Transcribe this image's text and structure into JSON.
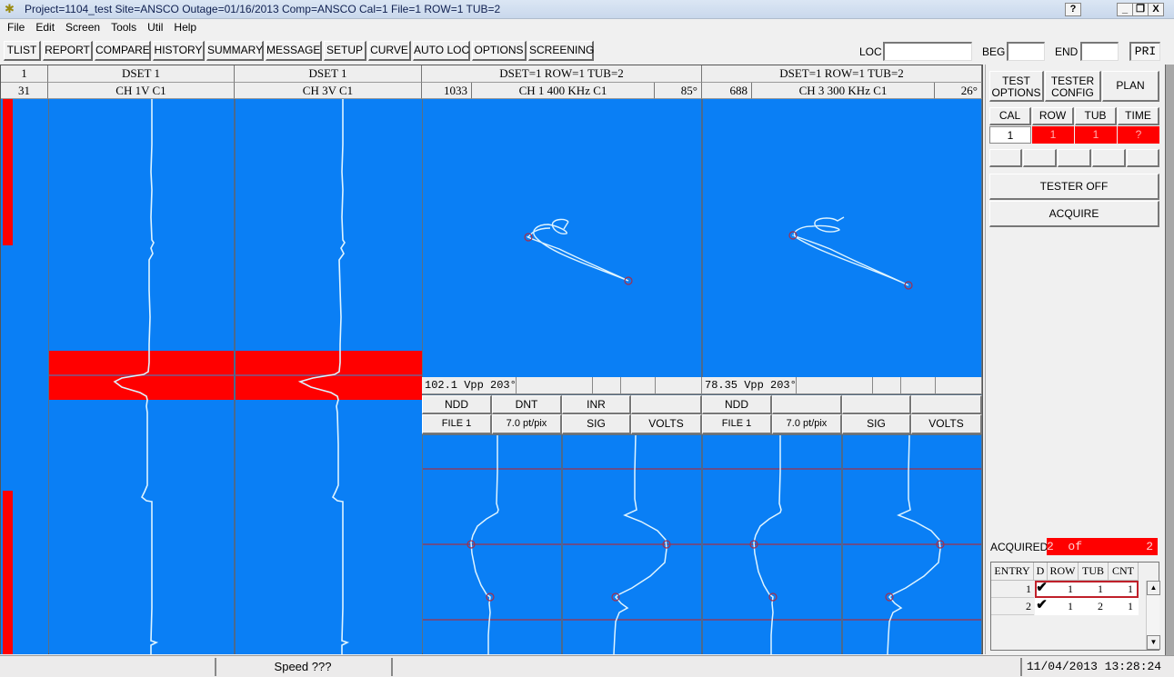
{
  "window": {
    "title": "Project=1104_test Site=ANSCO Outage=01/16/2013 Comp=ANSCO Cal=1 File=1 ROW=1  TUB=2",
    "app_icon": "eddy-current-app-icon",
    "help_btn": "?",
    "minimize_btn": "_",
    "restore_btn": "ɑ",
    "close_btn": "X"
  },
  "menu": [
    "File",
    "Edit",
    "Screen",
    "Tools",
    "Util",
    "Help"
  ],
  "toolbar": {
    "buttons": [
      "TLIST",
      "REPORT",
      "COMPARE",
      "HISTORY",
      "SUMMARY",
      "MESSAGE",
      "SETUP",
      "CURVE",
      "AUTO LOC",
      "OPTIONS",
      "SCREENING"
    ],
    "loc_label": "LOC",
    "loc_value": "",
    "beg_label": "BEG",
    "beg_value": "",
    "end_label": "END",
    "end_value": "",
    "pri_label": "PRI"
  },
  "strip": {
    "header_top": "1",
    "header_bottom": "31",
    "marker_color": "#ff0000"
  },
  "strip_charts": [
    {
      "dset": "DSET 1",
      "channel": "CH 1V C1"
    },
    {
      "dset": "DSET 1",
      "channel": "CH 3V C1"
    }
  ],
  "lissajous": [
    {
      "header": "DSET=1 ROW=1 TUB=2",
      "count": "1033",
      "channel": "CH 1 400 KHz C1",
      "angle": "85°",
      "readout": "102.1 Vpp 203°",
      "row1": [
        "NDD",
        "DNT",
        "INR",
        ""
      ],
      "row2": [
        "FILE 1",
        "7.0 pt/pix",
        "SIG",
        "VOLTS"
      ]
    },
    {
      "header": "DSET=1 ROW=1 TUB=2",
      "count": "688",
      "channel": "CH 3 300 KHz C1",
      "angle": "26°",
      "readout": "78.35 Vpp 203°",
      "row1": [
        "NDD",
        "",
        "",
        ""
      ],
      "row2": [
        "FILE 1",
        "7.0 pt/pix",
        "SIG",
        "VOLTS"
      ]
    }
  ],
  "colors": {
    "plot_bg": "#0a7ff5",
    "trace": "#dff4ff",
    "highlight": "#ff0000",
    "cursor_line": "#b0304a"
  },
  "right_panel": {
    "buttons_top": [
      {
        "label_line1": "TEST",
        "label_line2": "OPTIONS"
      },
      {
        "label_line1": "TESTER",
        "label_line2": "CONFIG"
      },
      {
        "label_line1": "PLAN",
        "label_line2": ""
      }
    ],
    "status_headers": [
      "CAL",
      "ROW",
      "TUB",
      "TIME"
    ],
    "status_values": [
      "1",
      "1",
      "1",
      "?"
    ],
    "tester_off_label": "TESTER OFF",
    "acquire_label": "ACQUIRE",
    "acquired_label": "ACQUIRED",
    "acquired_value": "2  of         2",
    "entry_table": {
      "headers": [
        "ENTRY",
        "D",
        "ROW",
        "TUB",
        "CNT"
      ],
      "rows": [
        {
          "entry": "1",
          "d": "✔",
          "row": "1",
          "tub": "1",
          "cnt": "1",
          "selected": true
        },
        {
          "entry": "2",
          "d": "✔",
          "row": "1",
          "tub": "2",
          "cnt": "1",
          "selected": false
        }
      ]
    }
  },
  "statusbar": {
    "pane1": "",
    "speed": "Speed  ???",
    "pane3": "",
    "datetime": "11/04/2013 13:28:24"
  }
}
